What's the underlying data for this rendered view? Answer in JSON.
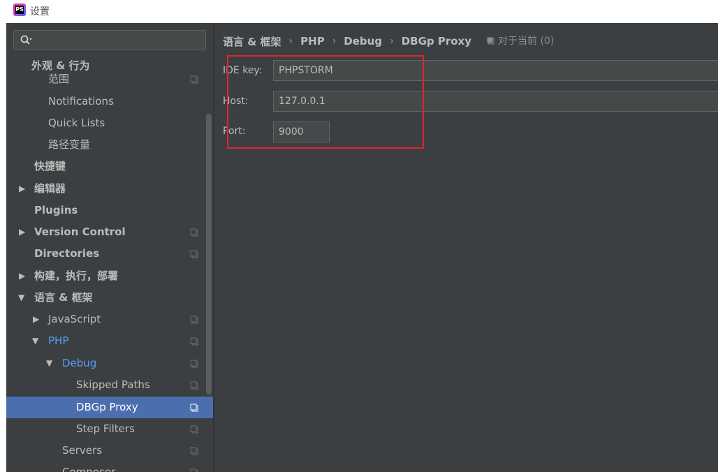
{
  "window": {
    "title": "设置",
    "logo_text": "PS"
  },
  "search": {
    "placeholder": ""
  },
  "sidebar": {
    "items": [
      {
        "label": "外观 & 行为",
        "bold": true
      },
      {
        "label": "范围"
      },
      {
        "label": "Notifications"
      },
      {
        "label": "Quick Lists"
      },
      {
        "label": "路径变量"
      },
      {
        "label": "快捷键",
        "bold": true
      },
      {
        "label": "编辑器",
        "bold": true
      },
      {
        "label": "Plugins",
        "bold": true
      },
      {
        "label": "Version Control",
        "bold": true
      },
      {
        "label": "Directories",
        "bold": true
      },
      {
        "label": "构建，执行，部署",
        "bold": true
      },
      {
        "label": "语言 & 框架",
        "bold": true
      },
      {
        "label": "JavaScript"
      },
      {
        "label": "PHP"
      },
      {
        "label": "Debug"
      },
      {
        "label": "Skipped Paths"
      },
      {
        "label": "DBGp Proxy",
        "selected": true
      },
      {
        "label": "Step Filters"
      },
      {
        "label": "Servers"
      },
      {
        "label": "Composer"
      }
    ]
  },
  "breadcrumb": {
    "items": [
      "语言 & 框架",
      "PHP",
      "Debug",
      "DBGp Proxy"
    ],
    "separator": "›"
  },
  "current_project": {
    "label": "对于当前 (0)"
  },
  "form": {
    "ide_key": {
      "label": "IDE key:",
      "value": "PHPSTORM"
    },
    "host": {
      "label": "Host:",
      "value": "127.0.0.1"
    },
    "port": {
      "label": "Port:",
      "value": "9000"
    }
  },
  "colors": {
    "background": "#3c3f41",
    "selection": "#4b6eaf",
    "link_blue": "#589df6",
    "highlight_red": "#e0242b"
  }
}
